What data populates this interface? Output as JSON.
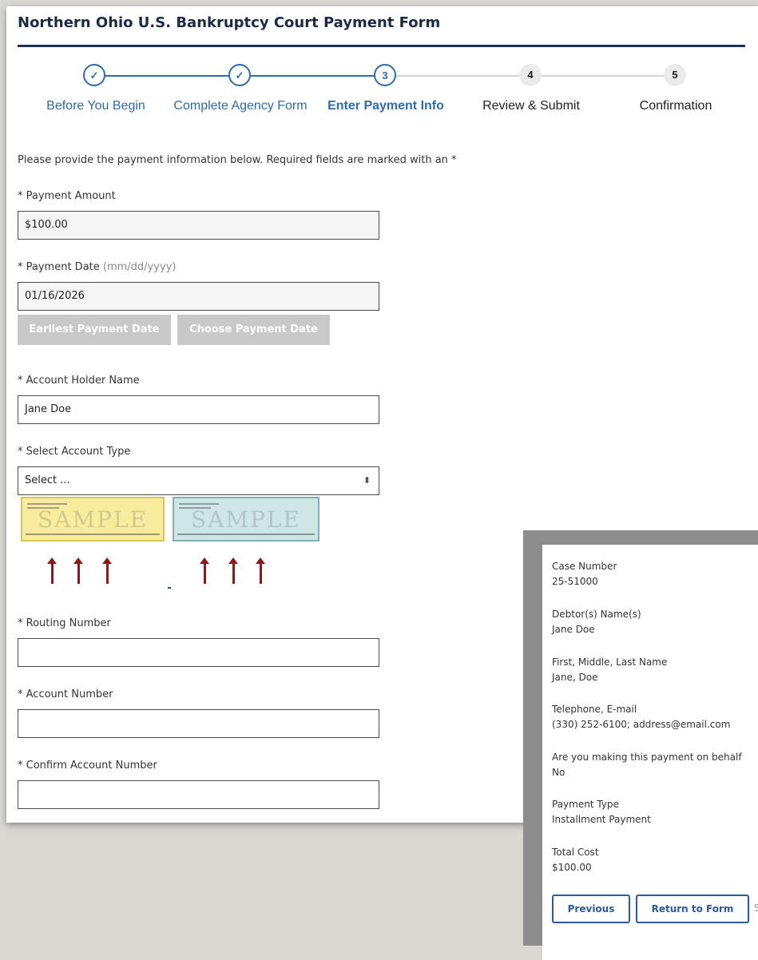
{
  "form": {
    "title": "Northern Ohio U.S. Bankruptcy Court Payment Form",
    "steps": [
      {
        "label": "Before You Begin",
        "marker": "✓",
        "state": "done"
      },
      {
        "label": "Complete Agency Form",
        "marker": "✓",
        "state": "done"
      },
      {
        "label": "Enter Payment Info",
        "marker": "3",
        "state": "current"
      },
      {
        "label": "Review & Submit",
        "marker": "4",
        "state": "todo"
      },
      {
        "label": "Confirmation",
        "marker": "5",
        "state": "todo"
      }
    ],
    "intro": "Please provide the payment information below. Required fields are marked with an *",
    "payment_amount": {
      "label": "* Payment Amount",
      "value": "$100.00"
    },
    "payment_date": {
      "label": "* Payment Date",
      "hint": "(mm/dd/yyyy)",
      "value": "01/16/2026"
    },
    "buttons": {
      "earliest": "Earliest Payment Date",
      "choose": "Choose Payment Date"
    },
    "account_holder": {
      "label": "* Account Holder Name",
      "value": "Jane Doe"
    },
    "account_type": {
      "label": "* Select Account Type",
      "value": "Select ..."
    },
    "routing": {
      "label": "* Routing Number",
      "value": ""
    },
    "account_number": {
      "label": "* Account Number",
      "value": ""
    },
    "confirm_account": {
      "label": "* Confirm Account Number",
      "value": ""
    },
    "sample_watermark": "SAMPLE"
  },
  "summary": {
    "items": [
      {
        "label": "Case Number",
        "value": "25-51000"
      },
      {
        "label": "Debtor(s) Name(s)",
        "value": "Jane Doe"
      },
      {
        "label": "First, Middle, Last Name",
        "value": "Jane, Doe"
      },
      {
        "label": "Telephone, E-mail",
        "value": "(330) 252-6100; address@email.com"
      },
      {
        "label": "Are you making this payment on behalf",
        "value": "No"
      },
      {
        "label": "Payment Type",
        "value": "Installment Payment"
      },
      {
        "label": "Total Cost",
        "value": "$100.00"
      }
    ],
    "previous": "Previous",
    "return_to_form": "Return to Form",
    "edge_glyph": "S"
  },
  "colors": {
    "brand_navy": "#1d3060",
    "step_blue": "#2c6bb0",
    "disabled_gray": "#c8c8c8",
    "arrow_red": "#8b1a1a"
  },
  "icons": {
    "select_caret": "select-caret-icon",
    "check_done": "checkmark-icon"
  }
}
